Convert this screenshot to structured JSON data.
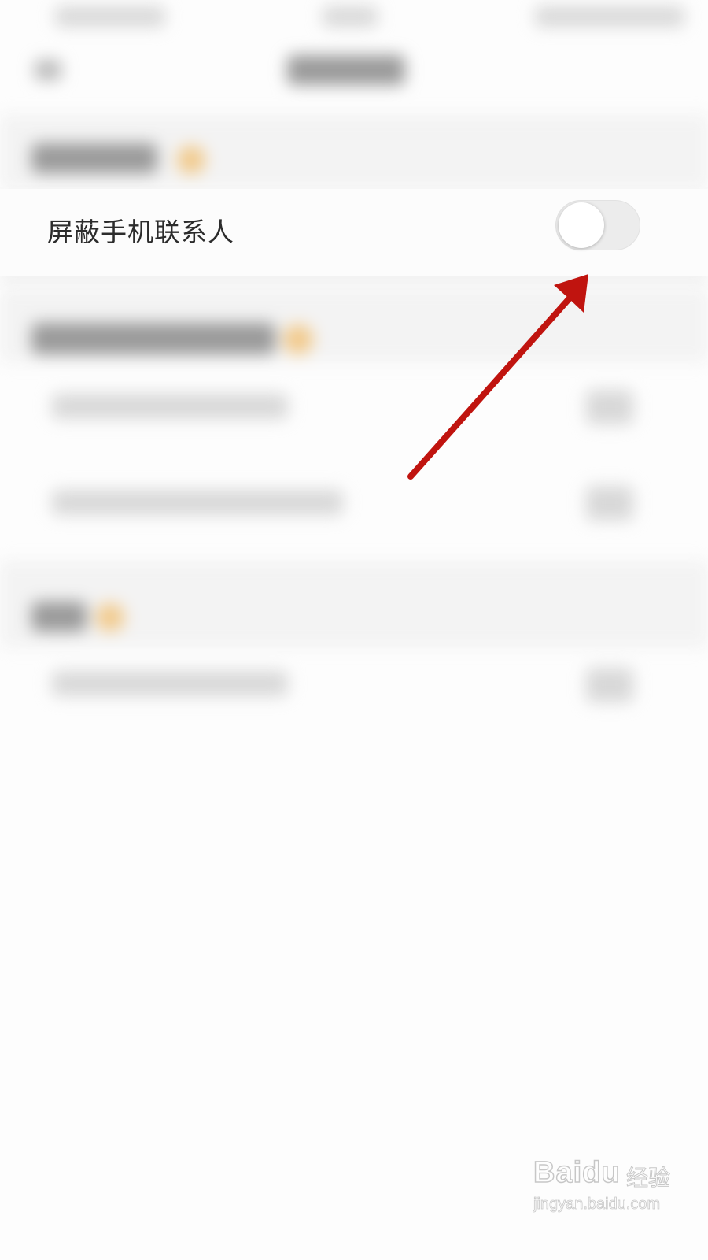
{
  "setting": {
    "label": "屏蔽手机联系人",
    "toggle_on": false
  },
  "annotation": {
    "arrow_color": "#c0140f"
  },
  "watermark": {
    "logo": "Baidu",
    "product": "经验",
    "url": "jingyan.baidu.com"
  },
  "colors": {
    "background": "#fdfdfd",
    "label_text": "#2c2c2c",
    "toggle_off_track": "#ececec",
    "accent_orange": "#f2c98a"
  }
}
